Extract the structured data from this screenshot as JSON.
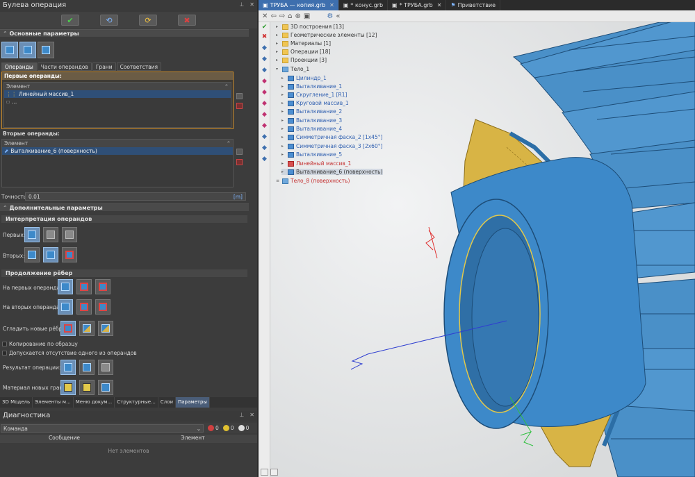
{
  "panel": {
    "title": "Булева операция",
    "pin": "⊥",
    "close": "✕"
  },
  "top_buttons": {
    "ok": "✔",
    "apply": "⟲",
    "preview": "⟳",
    "cancel": "✖"
  },
  "basic": {
    "header": "Основные параметры",
    "tabs": [
      "Операнды",
      "Части операндов",
      "Грани",
      "Соответствия"
    ],
    "first_label": "Первые операнды:",
    "first_col": "Элемент",
    "first_items": [
      "Линейный массив_1",
      "..."
    ],
    "second_label": "Вторые операнды:",
    "second_col": "Элемент",
    "second_items": [
      "Выталкивание_6 (поверхность)"
    ],
    "precision_label": "Точность:",
    "precision_value": "0.01",
    "precision_unit": "[m]"
  },
  "extra": {
    "header": "Дополнительные параметры",
    "interp_header": "Интерпретация операндов",
    "first": "Первых:",
    "second": "Вторых:",
    "edges_header": "Продолжение рёбер",
    "on_first": "На первых операндах:",
    "on_second": "На вторых операндах:",
    "smooth": "Сгладить новые рёбра:",
    "copy_pattern": "Копирование по образцу",
    "allow_missing": "Допускается отсутствие одного из операндов",
    "result": "Результат операции:",
    "material": "Материал новых граней:"
  },
  "bottom_tabs": [
    "3D Модель",
    "Элементы м...",
    "Меню докум...",
    "Структурные...",
    "Слои",
    "Параметры"
  ],
  "diagnostics": {
    "title": "Диагностика",
    "combo": "Команда",
    "errors": "0",
    "warnings": "0",
    "info": "0",
    "col_message": "Сообщение",
    "col_element": "Элемент",
    "empty": "Нет элементов"
  },
  "doc_tabs": [
    {
      "label": "ТРУБА — копия.grb",
      "active": true,
      "close": "✕"
    },
    {
      "label": "* конус.grb",
      "active": false,
      "close": ""
    },
    {
      "label": "* ТРУБА.grb",
      "active": false,
      "close": "✕"
    },
    {
      "label": "Приветствие",
      "active": false,
      "close": ""
    }
  ],
  "tree": [
    {
      "label": "3D построения [13]",
      "icon": "folder",
      "style": ""
    },
    {
      "label": "Геометрические элементы [12]",
      "icon": "folder",
      "style": ""
    },
    {
      "label": "Материалы [1]",
      "icon": "folder",
      "style": ""
    },
    {
      "label": "Операции [18]",
      "icon": "folder",
      "style": ""
    },
    {
      "label": "Проекции [3]",
      "icon": "folder",
      "style": ""
    },
    {
      "label": "Тело_1",
      "icon": "body",
      "style": ""
    },
    {
      "label": "Цилиндр_1",
      "icon": "op",
      "style": "blue"
    },
    {
      "label": "Выталкивание_1",
      "icon": "op",
      "style": "blue"
    },
    {
      "label": "Скругление_1 [R1]",
      "icon": "op",
      "style": "blue"
    },
    {
      "label": "Круговой массив_1",
      "icon": "op",
      "style": "blue"
    },
    {
      "label": "Выталкивание_2",
      "icon": "op",
      "style": "blue"
    },
    {
      "label": "Выталкивание_3",
      "icon": "op",
      "style": "blue"
    },
    {
      "label": "Выталкивание_4",
      "icon": "op",
      "style": "blue"
    },
    {
      "label": "Симметричная фаска_2 [1x45°]",
      "icon": "op",
      "style": "blue"
    },
    {
      "label": "Симметричная фаска_3 [2x60°]",
      "icon": "op",
      "style": "blue"
    },
    {
      "label": "Выталкивание_5",
      "icon": "op",
      "style": "blue"
    },
    {
      "label": "Линейный массив_1",
      "icon": "red",
      "style": "red"
    },
    {
      "label": "Выталкивание_6 (поверхность)",
      "icon": "op",
      "style": "sel"
    },
    {
      "label": "Тело_8 (поверхность)",
      "icon": "body",
      "style": "red"
    }
  ],
  "colors": {
    "part_blue": "#3d89c9",
    "face_yellow": "#e2c84a",
    "axis_red": "#e03030",
    "axis_blue": "#2f3fd0",
    "axis_green": "#30c040"
  }
}
